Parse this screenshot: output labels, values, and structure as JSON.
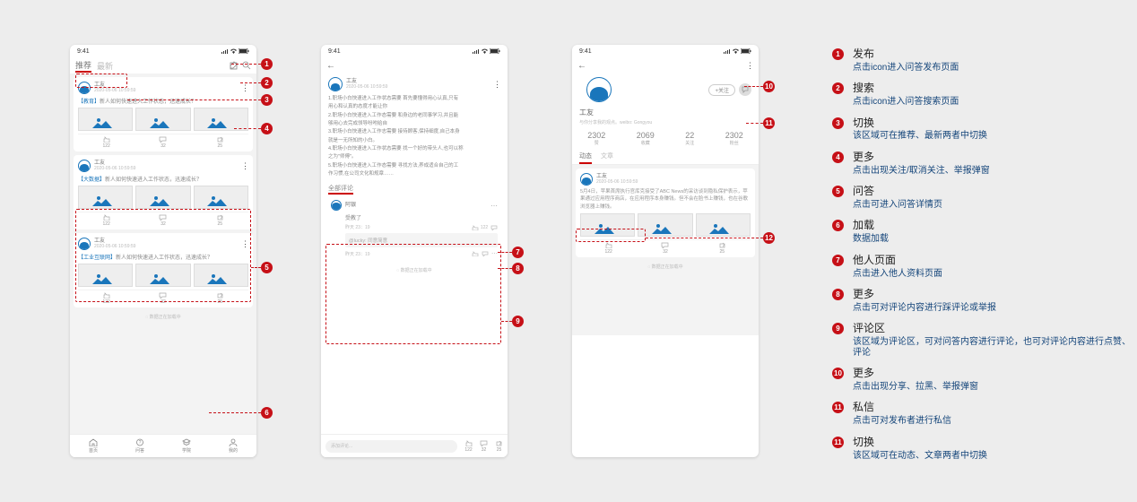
{
  "status_time": "9:41",
  "tabs": {
    "recommend": "推荐",
    "latest": "最新"
  },
  "user": {
    "name": "工友",
    "date": "2020-05-06 10:59:59"
  },
  "feed_titles": {
    "c1_tag": "【教育】",
    "c1_txt": "新人如何快速进入工作状态，迅速成长？",
    "c2_tag": "【大数据】",
    "c2_txt": "新人如何快速进入工作状态，迅速成长？",
    "c3_tag": "【工业互联网】",
    "c3_txt": "新人如何快速进入工作状态，迅速成长？"
  },
  "counts": {
    "like": "122",
    "comment": "32",
    "share": "25"
  },
  "loading": "数据正在加载中",
  "nav": {
    "home": "首页",
    "wenda": "问答",
    "study": "学院",
    "me": "我的"
  },
  "detail": {
    "l1": "1.职场小白快速进入工作状态需要 首先要懂得用心认真,只有",
    "l1b": "用心和认真的态度才能让你",
    "l2": "2.职场小白快速进入工作态需要 和身边的老同事学习,并且能",
    "l2b": "够用心去完成领导吩咐给自",
    "l3": "3.职场小白快速进入工作志需要 接待顾客,保持细度,自己本身",
    "l3b": "就是一无所知的小白。",
    "l4": "4.职场小白快速进入工作状态需要 找一个好的带头人,也可以称",
    "l4b": "之为\"师傅\"。",
    "l5": "5.职场小白快速进入工作态需要 寻找方法,养成适合自己的工",
    "l5b": "作习惯,在公司文化和规章……"
  },
  "all_comments": "全部评论",
  "comment": {
    "name": "阿银",
    "body": "受教了",
    "ts": "昨天 23：19",
    "like": "122",
    "reply": "@lucky: 同意简意",
    "reply_ts": "昨天 23：19"
  },
  "input_ph": "添加评论...",
  "profile": {
    "follow_btn": "+关注",
    "name": "工友",
    "bio": "与你分享我的观点。weibo: Gongyou",
    "stats": [
      [
        "2302",
        "赞"
      ],
      [
        "2069",
        "收藏"
      ],
      [
        "22",
        "关注"
      ],
      [
        "2302",
        "粉丝"
      ]
    ],
    "tabs": {
      "moments": "动态",
      "article": "文章"
    },
    "post": "5月4日，苹果首席执行官库克接受了ABC News的采访谈到隐私保护表示，苹果通过应用程序商店，在应用程序本身赚钱。但不会在脸书上赚钱，也在谷歌浏览器上赚钱。"
  },
  "legend": [
    {
      "n": "1",
      "t": "发布",
      "s": "点击icon进入问答发布页面"
    },
    {
      "n": "2",
      "t": "搜索",
      "s": "点击icon进入问答搜索页面"
    },
    {
      "n": "3",
      "t": "切换",
      "s": "该区域可在推荐、最新两者中切换"
    },
    {
      "n": "4",
      "t": "更多",
      "s": "点击出现关注/取消关注、举报弹窗"
    },
    {
      "n": "5",
      "t": "问答",
      "s": "点击可进入问答详情页"
    },
    {
      "n": "6",
      "t": "加载",
      "s": "数据加载"
    },
    {
      "n": "7",
      "t": "他人页面",
      "s": "点击进入他人资料页面"
    },
    {
      "n": "8",
      "t": "更多",
      "s": "点击可对评论内容进行踩评论或举报"
    },
    {
      "n": "9",
      "t": "评论区",
      "s": "该区域为评论区，可对问答内容进行评论，也可对评论内容进行点赞、评论"
    },
    {
      "n": "10",
      "t": "更多",
      "s": "点击出现分享、拉黑、举报弹窗"
    },
    {
      "n": "11",
      "t": "私信",
      "s": "点击可对发布者进行私信"
    },
    {
      "n": "11",
      "t": "切换",
      "s": "该区域可在动态、文章两者中切换"
    }
  ]
}
